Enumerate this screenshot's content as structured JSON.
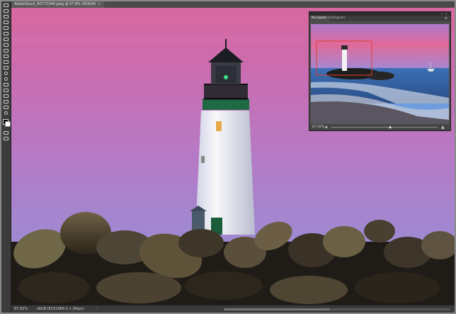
{
  "document": {
    "tab_title": "AdobeStock_80772344.jpeg @ 67.8% (RGB/8)",
    "close_glyph": "×"
  },
  "status_bar": {
    "zoom": "67.92%",
    "doc_info": "sRGB IEC61966-2.1 (8bpc)",
    "arrow": "›"
  },
  "navigator": {
    "tabs": [
      {
        "label": "Navigator",
        "active": true
      },
      {
        "label": "Histogram",
        "active": false
      }
    ],
    "menu_icon": "≡",
    "window_controls": "»  ×",
    "zoom_value": "67.92%",
    "zoom_out_glyph": "▲",
    "zoom_in_glyph": "▲",
    "zoom_level_fraction": 0.55
  },
  "icons": {
    "tools": [
      "move-icon",
      "marquee-icon",
      "lasso-icon",
      "quick-select-icon",
      "crop-icon",
      "eyedropper-icon",
      "healing-icon",
      "brush-icon",
      "clone-stamp-icon",
      "history-brush-icon",
      "eraser-icon",
      "gradient-icon",
      "blur-icon",
      "dodge-icon",
      "pen-icon",
      "type-icon",
      "path-select-icon",
      "shape-icon",
      "hand-icon",
      "zoom-icon"
    ]
  },
  "colors": {
    "sky_top": "#d36aa8",
    "sky_bottom": "#8f8fd0",
    "lighthouse_roof": "#1a5c3a",
    "panel_bg": "#4d4d4d",
    "nav_view_box": "#e23b2e"
  }
}
